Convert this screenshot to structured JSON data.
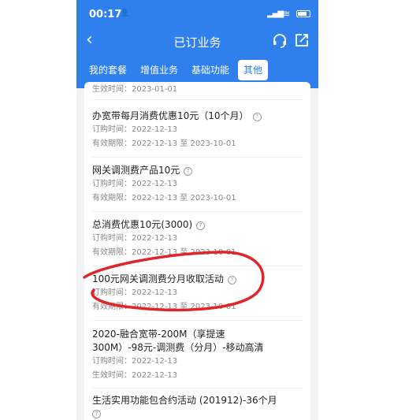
{
  "status_bar": {
    "time": "00:17"
  },
  "nav": {
    "title": "已订业务"
  },
  "tabs": [
    "我的套餐",
    "增值业务",
    "基础功能",
    "其他"
  ],
  "partial_top": {
    "label": "生效时间：",
    "value": "2023-01-01"
  },
  "items": [
    {
      "name": "办宽带每月消费优惠10元（10个月）",
      "rows": [
        {
          "label": "订购时间：",
          "value": "2022-12-13"
        },
        {
          "label": "有效期限：",
          "value": "2022-12-13 至 2023-10-01"
        }
      ]
    },
    {
      "name": "网关调测费产品10元",
      "rows": [
        {
          "label": "订购时间：",
          "value": "2022-12-13"
        },
        {
          "label": "有效期限：",
          "value": "2022-12-13 至 2023-10-01"
        }
      ]
    },
    {
      "name": "总消费优惠10元(3000)",
      "rows": [
        {
          "label": "订购时间：",
          "value": "2022-12-13"
        },
        {
          "label": "有效期限：",
          "value": "2022-12-13 至 2023-10-01"
        }
      ]
    },
    {
      "name": "100元网关调测费分月收取活动",
      "rows": [
        {
          "label": "订购时间：",
          "value": "2022-12-13"
        },
        {
          "label": "有效期限：",
          "value": "2022-12-13 至 2023-10-01"
        }
      ]
    },
    {
      "name_line1": "2020-融合宽带-200M（享提速",
      "name_line2": "300M）-98元-调测费（分月）-移动高清",
      "rows": [
        {
          "label": "订购时间：",
          "value": "2022-12-13"
        },
        {
          "label": "生效时间：",
          "value": "2022-12-13"
        }
      ]
    },
    {
      "name": "生活实用功能包合约活动 (201912)-36个月"
    }
  ],
  "colors": {
    "header": "#2f80ec",
    "scribble": "#e0262b"
  }
}
